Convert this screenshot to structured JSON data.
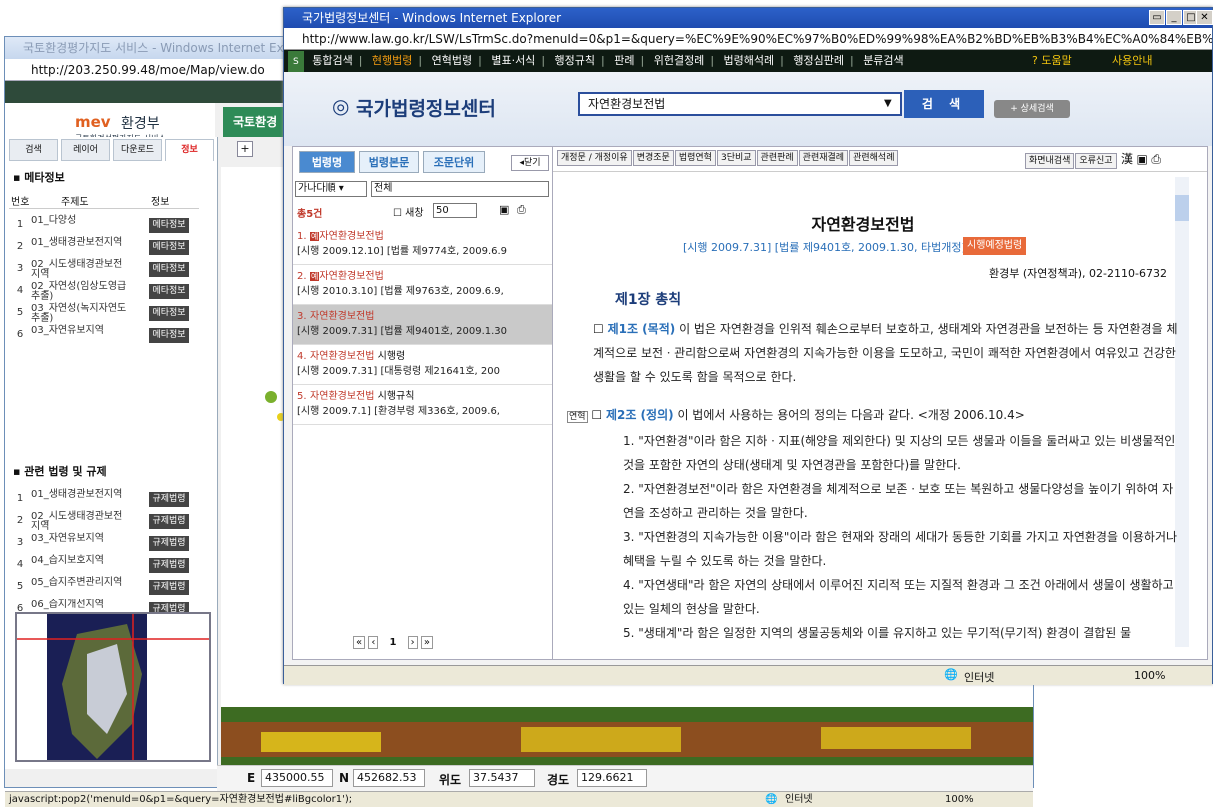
{
  "back_window": {
    "title": "국토환경평가지도 서비스 - Windows Internet Explorer",
    "address": "http://203.250.99.48/moe/Map/view.do",
    "logo": "mev",
    "logo_org": "환경부",
    "logo_sub": "국토환경성평가지도 서비스",
    "green_tab": "국토환경",
    "tabs": [
      "검색",
      "레이어",
      "다운로드",
      "정보"
    ],
    "meta_section": "메타정보",
    "meta_headers": [
      "번호",
      "주제도",
      "정보"
    ],
    "meta_rows": [
      {
        "n": "1",
        "t": "01_다양성",
        "b": "메타정보"
      },
      {
        "n": "2",
        "t": "01_생태경관보전지역",
        "b": "메타정보"
      },
      {
        "n": "3",
        "t": "02_시도생태경관보전지역",
        "b": "메타정보"
      },
      {
        "n": "4",
        "t": "02_자연성(임상도영급 추출)",
        "b": "메타정보"
      },
      {
        "n": "5",
        "t": "03_자연성(녹지자연도 추출)",
        "b": "메타정보"
      },
      {
        "n": "6",
        "t": "03_자연유보지역",
        "b": "메타정보"
      }
    ],
    "law_section": "관련 법령 및 규제",
    "law_rows": [
      {
        "n": "1",
        "t": "01_생태경관보전지역",
        "b": "규제법령"
      },
      {
        "n": "2",
        "t": "02_시도생태경관보전지역",
        "b": "규제법령"
      },
      {
        "n": "3",
        "t": "03_자연유보지역",
        "b": "규제법령"
      },
      {
        "n": "4",
        "t": "04_습지보호지역",
        "b": "규제법령"
      },
      {
        "n": "5",
        "t": "05_습지주변관리지역",
        "b": "규제법령"
      },
      {
        "n": "6",
        "t": "06_습지개선지역",
        "b": "규제법령"
      }
    ],
    "coords": {
      "e_label": "E",
      "e": "435000.55",
      "n_label": "N",
      "n": "452682.53",
      "lat_label": "위도",
      "lat": "37.5437",
      "lon_label": "경도",
      "lon": "129.6621"
    },
    "status": "javascript:pop2('menuId=0&p1=&query=자연환경보전법#liBgcolor1');",
    "status_zone": "인터넷",
    "status_zoom": "100%"
  },
  "front_window": {
    "title": "국가법령정보센터 - Windows Internet Explorer",
    "address": "http://www.law.go.kr/LSW/LsTrmSc.do?menuId=0&p1=&query=%EC%9E%90%EC%97%B0%ED%99%98%EA%B2%BD%EB%B3%B4%EC%A0%84%EB%B2%95#liBgcolor1",
    "menu": [
      "통합검색",
      "현행법령",
      "연혁법령",
      "별표·서식",
      "행정규칙",
      "판례",
      "위헌결정례",
      "법령해석례",
      "행정심판례",
      "분류검색"
    ],
    "menu_right": [
      "? 도움말",
      "사용안내"
    ],
    "logo": "국가법령정보센터",
    "search_value": "자연환경보전법",
    "search_button": "검 색",
    "adv_button": "+ 상세검색",
    "left_tabs": [
      "법령명",
      "법령본문",
      "조문단위"
    ],
    "close_label": "닫기",
    "sort_select": "가나다順",
    "filter_select": "전체",
    "count_label": "총5건",
    "new_window_label": "새창",
    "page_size": "50",
    "results": [
      {
        "idx": "1.",
        "badge": "예",
        "name": "자연환경보전법",
        "suffix": "",
        "meta": "[시행 2009.12.10] [법률 제9774호, 2009.6.9"
      },
      {
        "idx": "2.",
        "badge": "예",
        "name": "자연환경보전법",
        "suffix": "",
        "meta": "[시행 2010.3.10] [법률 제9763호, 2009.6.9,"
      },
      {
        "idx": "3.",
        "badge": "",
        "name": "자연환경보전법",
        "suffix": "",
        "meta": "[시행 2009.7.31] [법률 제9401호, 2009.1.30"
      },
      {
        "idx": "4.",
        "badge": "",
        "name": "자연환경보전법",
        "suffix": " 시행령",
        "meta": "[시행 2009.7.31] [대통령령 제21641호, 200"
      },
      {
        "idx": "5.",
        "badge": "",
        "name": "자연환경보전법",
        "suffix": " 시행규칙",
        "meta": "[시행 2009.7.1] [환경부령 제336호, 2009.6,"
      }
    ],
    "pager": "1",
    "toolbar_buttons": [
      "개정문 / 개정이유",
      "변경조문",
      "법령연혁",
      "3단비교",
      "관련판례",
      "관련재결례",
      "관련해석례"
    ],
    "toolbar_right": [
      "화면내검색",
      "오류신고"
    ],
    "doc": {
      "title": "자연환경보전법",
      "sub": "[시행 2009.7.31] [법률 제9401호, 2009.1.30, 타법개정]",
      "sub_badge": "시행예정법령",
      "ministry": "환경부 (자연정책과), 02-2110-6732",
      "chapter": "제1장 총칙",
      "art1_head": "제1조 (목적)",
      "art1_body": "이 법은 자연환경을 인위적 훼손으로부터 보호하고, 생태계와 자연경관을 보전하는 등 자연환경을 체계적으로 보전ㆍ관리함으로써 자연환경의 지속가능한 이용을 도모하고, 국민이 쾌적한 자연환경에서 여유있고 건강한 생활을 할 수 있도록 함을 목적으로 한다.",
      "art2_tag": "연혁",
      "art2_head": "제2조 (정의)",
      "art2_body": "이 법에서 사용하는 용어의 정의는 다음과 같다. <개정 2006.10.4>",
      "items": [
        "1. \"자연환경\"이라 함은 지하ㆍ지표(해양을 제외한다) 및 지상의 모든 생물과 이들을 둘러싸고 있는 비생물적인 것을 포함한 자연의 상태(생태계 및 자연경관을 포함한다)를 말한다.",
        "2. \"자연환경보전\"이라 함은 자연환경을 체계적으로 보존ㆍ보호 또는 복원하고 생물다양성을 높이기 위하여 자연을 조성하고 관리하는 것을 말한다.",
        "3. \"자연환경의 지속가능한 이용\"이라 함은 현재와 장래의 세대가 동등한 기회를 가지고 자연환경을 이용하거나 혜택을 누릴 수 있도록 하는 것을 말한다.",
        "4. \"자연생태\"라 함은 자연의 상태에서 이루어진 지리적 또는 지질적 환경과 그 조건 아래에서 생물이 생활하고 있는 일체의 현상을 말한다.",
        "5. \"생태계\"라 함은 일정한 지역의 생물공동체와 이를 유지하고 있는 무기적(무기적) 환경이 결합된 물"
      ]
    },
    "status_zone": "인터넷",
    "status_zoom": "100%"
  },
  "colors": {
    "accent": "#c0392b",
    "ie_blue": "#1f4cb0",
    "menu_bg": "#0e1a12",
    "menu_active": "#f39c12",
    "green": "#2e8b57"
  }
}
